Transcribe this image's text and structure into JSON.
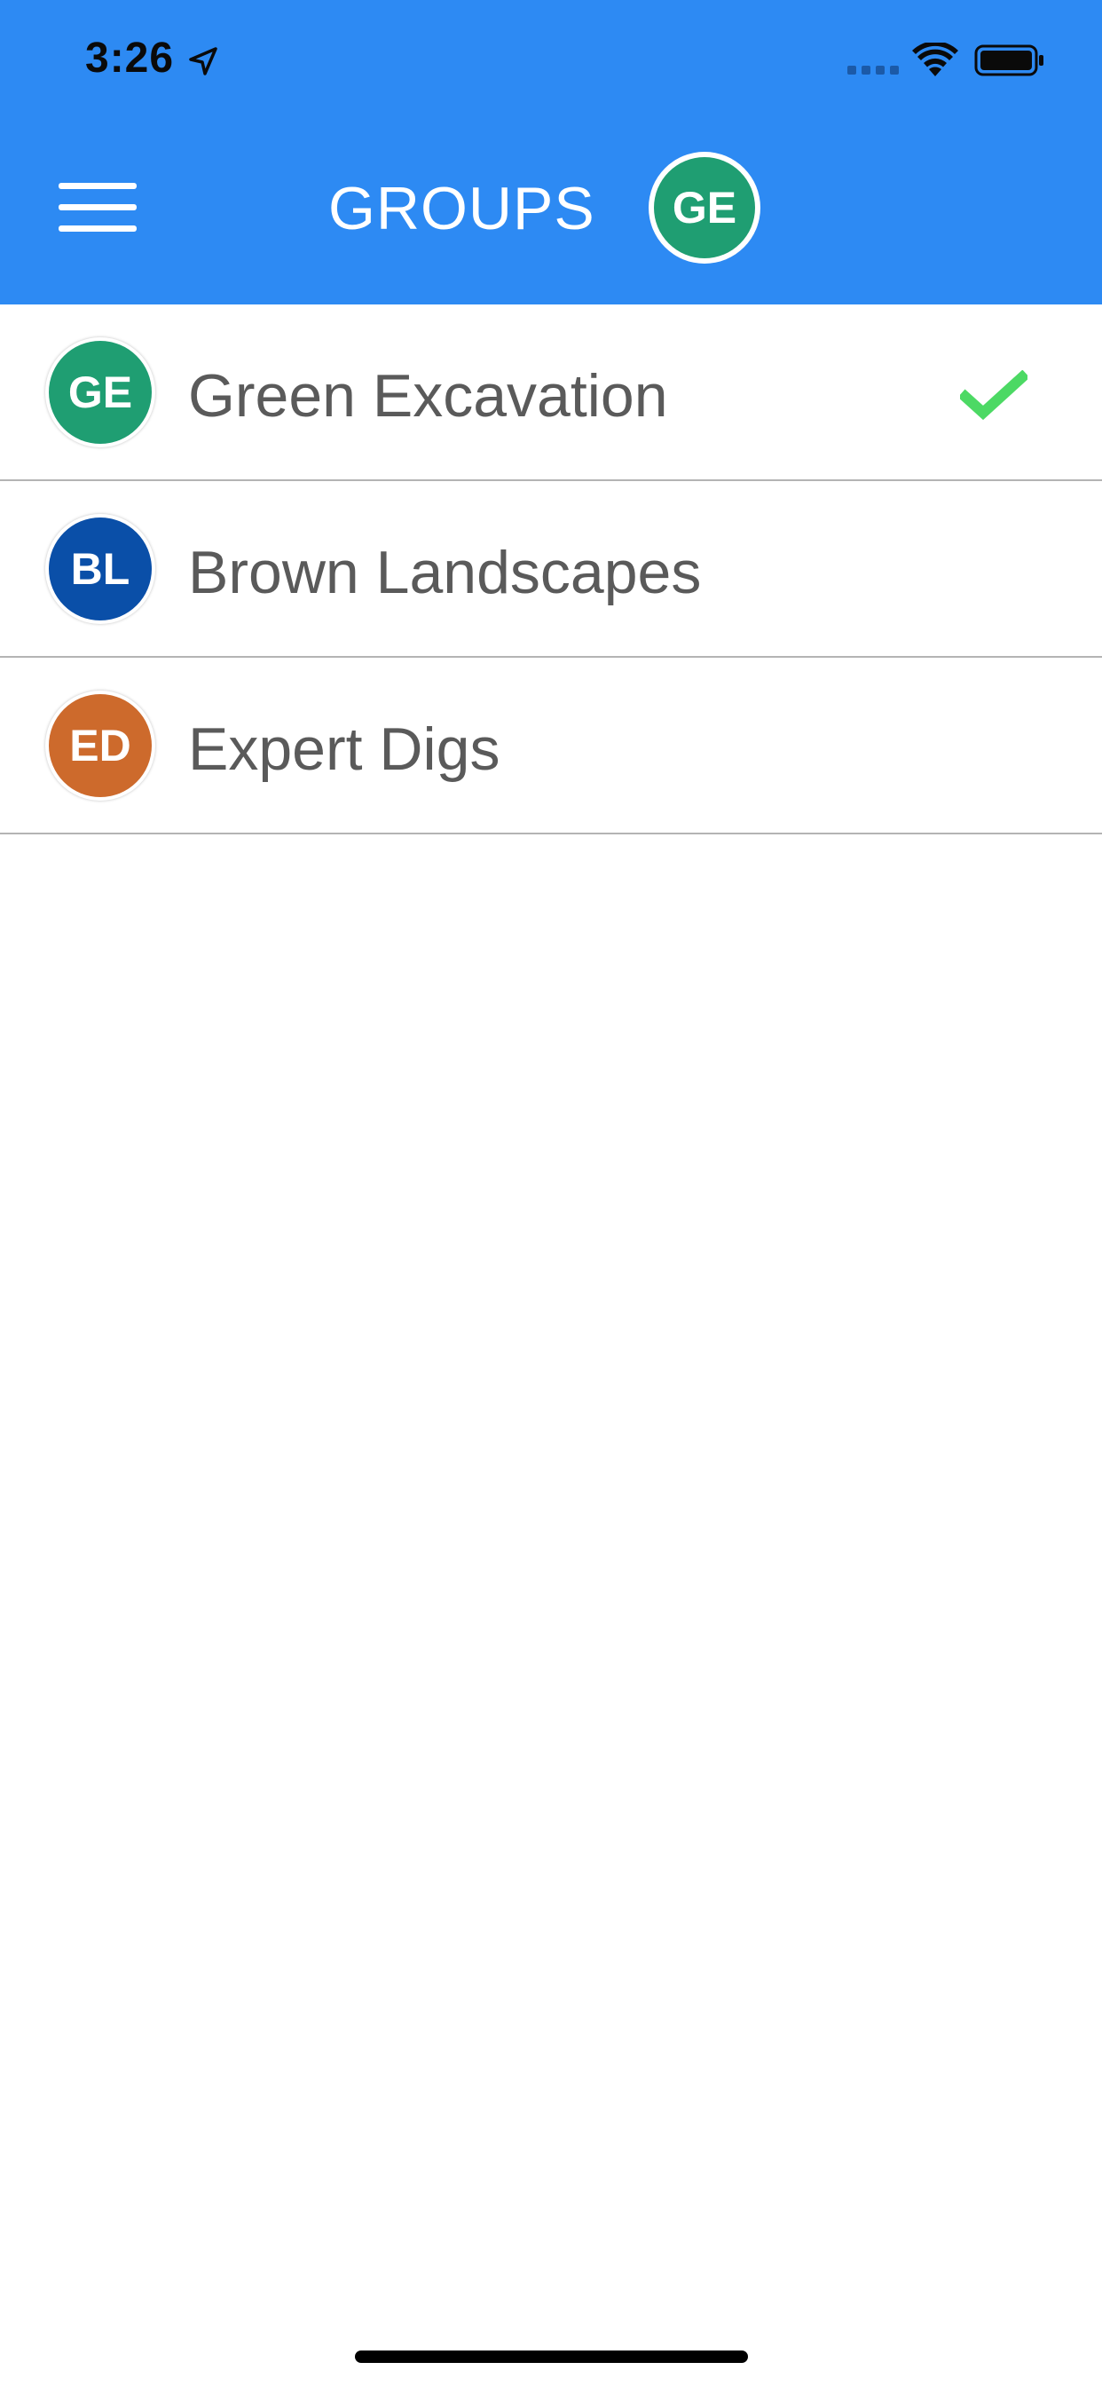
{
  "status_bar": {
    "time": "3:26",
    "icons": [
      "location-arrow-icon",
      "signal-icon",
      "wifi-icon",
      "battery-icon"
    ]
  },
  "nav": {
    "title": "GROUPS",
    "menu_icon": "hamburger-menu-icon",
    "current_group_initials": "GE"
  },
  "groups": [
    {
      "initials": "GE",
      "name": "Green Excavation",
      "color": "#1f9e72",
      "selected": true
    },
    {
      "initials": "BL",
      "name": "Brown Landscapes",
      "color": "#0a4fa8",
      "selected": false
    },
    {
      "initials": "ED",
      "name": "Expert Digs",
      "color": "#cd6a2c",
      "selected": false
    }
  ],
  "colors": {
    "header_background": "#2d8af3",
    "check_green": "#4cd964",
    "text_gray": "#5a5a5a",
    "divider": "#b4b4b4"
  }
}
